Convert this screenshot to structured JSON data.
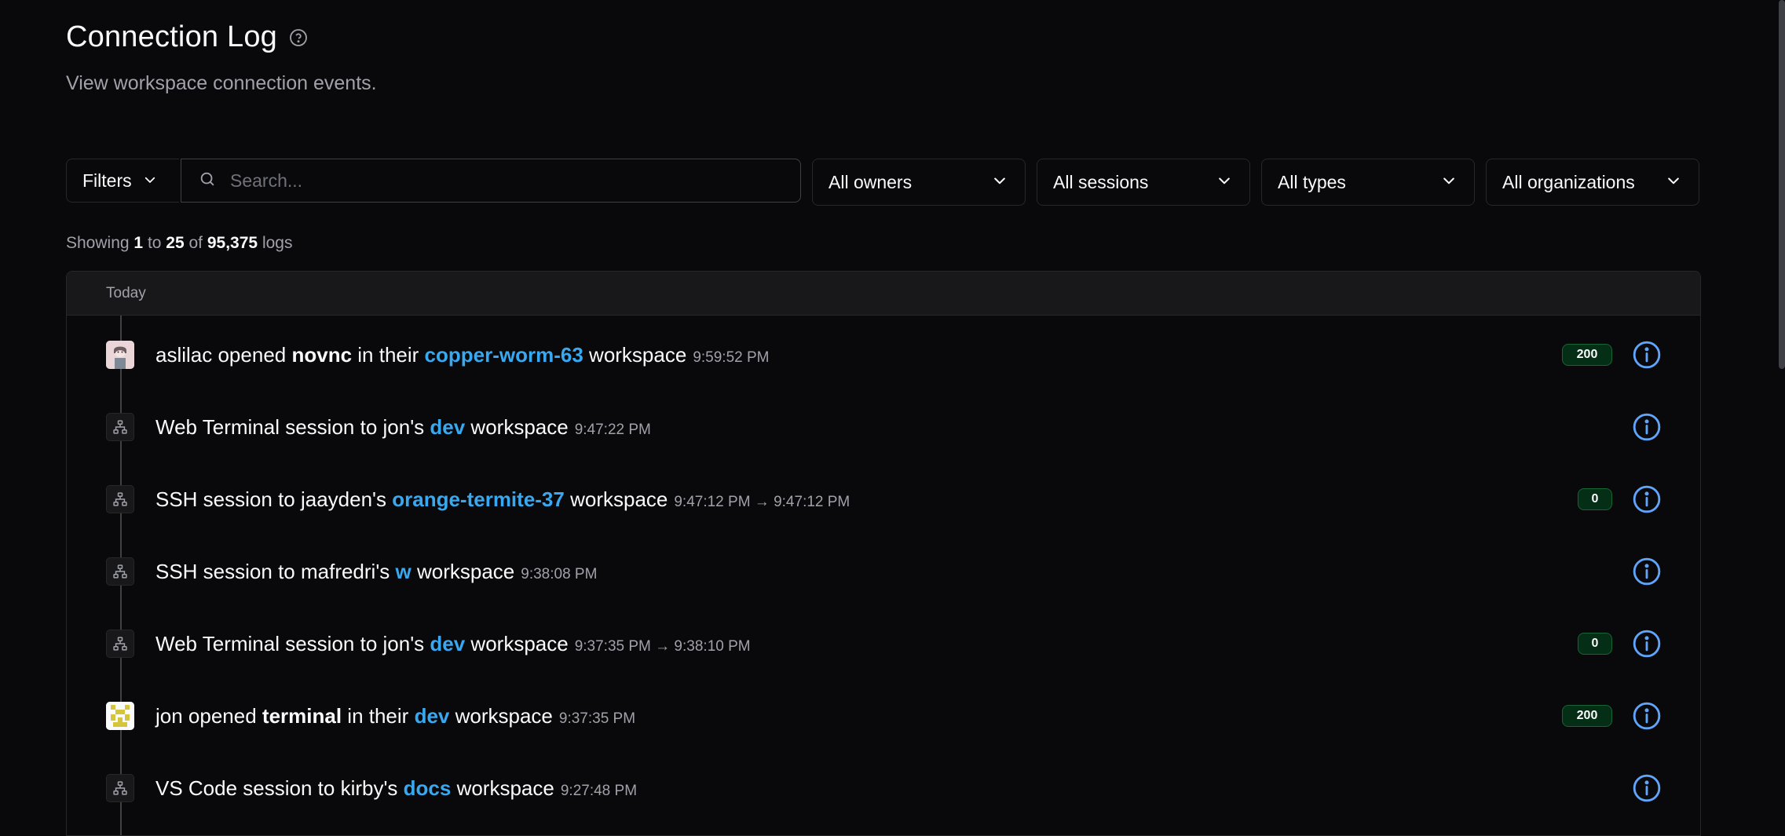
{
  "header": {
    "title": "Connection Log",
    "subtitle": "View workspace connection events."
  },
  "filters": {
    "filters_label": "Filters",
    "search_placeholder": "Search...",
    "owners": "All owners",
    "sessions": "All sessions",
    "types": "All types",
    "organizations": "All organizations"
  },
  "pagination": {
    "prefix": "Showing",
    "start": "1",
    "to": "to",
    "end": "25",
    "of": "of",
    "total": "95,375",
    "suffix": "logs"
  },
  "table": {
    "group_label": "Today",
    "rows": [
      {
        "avatar": "user-avatar",
        "pre": "aslilac opened ",
        "bold": "novnc",
        "mid": " in their ",
        "link": "copper-worm-63",
        "post": " workspace",
        "time": "9:59:52 PM",
        "badge": "200"
      },
      {
        "avatar": "network-icon",
        "pre": "Web Terminal session to jon's ",
        "bold": "",
        "mid": "",
        "link": "dev",
        "post": " workspace",
        "time": "9:47:22 PM",
        "badge": ""
      },
      {
        "avatar": "network-icon",
        "pre": "SSH session to jaayden's ",
        "bold": "",
        "mid": "",
        "link": "orange-termite-37",
        "post": " workspace",
        "time": "9:47:12 PM → 9:47:12 PM",
        "badge": "0"
      },
      {
        "avatar": "network-icon",
        "pre": "SSH session to mafredri's ",
        "bold": "",
        "mid": "",
        "link": "w",
        "post": " workspace",
        "time": "9:38:08 PM",
        "badge": ""
      },
      {
        "avatar": "network-icon",
        "pre": "Web Terminal session to jon's ",
        "bold": "",
        "mid": "",
        "link": "dev",
        "post": " workspace",
        "time": "9:37:35 PM → 9:38:10 PM",
        "badge": "0"
      },
      {
        "avatar": "user-avatar",
        "pre": "jon opened ",
        "bold": "terminal",
        "mid": " in their ",
        "link": "dev",
        "post": " workspace",
        "time": "9:37:35 PM",
        "badge": "200"
      },
      {
        "avatar": "network-icon",
        "pre": "VS Code session to kirby's ",
        "bold": "",
        "mid": "",
        "link": "docs",
        "post": " workspace",
        "time": "9:27:48 PM",
        "badge": ""
      }
    ]
  },
  "colors": {
    "background": "#09090b",
    "link": "#38a8f0",
    "info_icon": "#60a5fa",
    "badge_border": "#166534"
  }
}
